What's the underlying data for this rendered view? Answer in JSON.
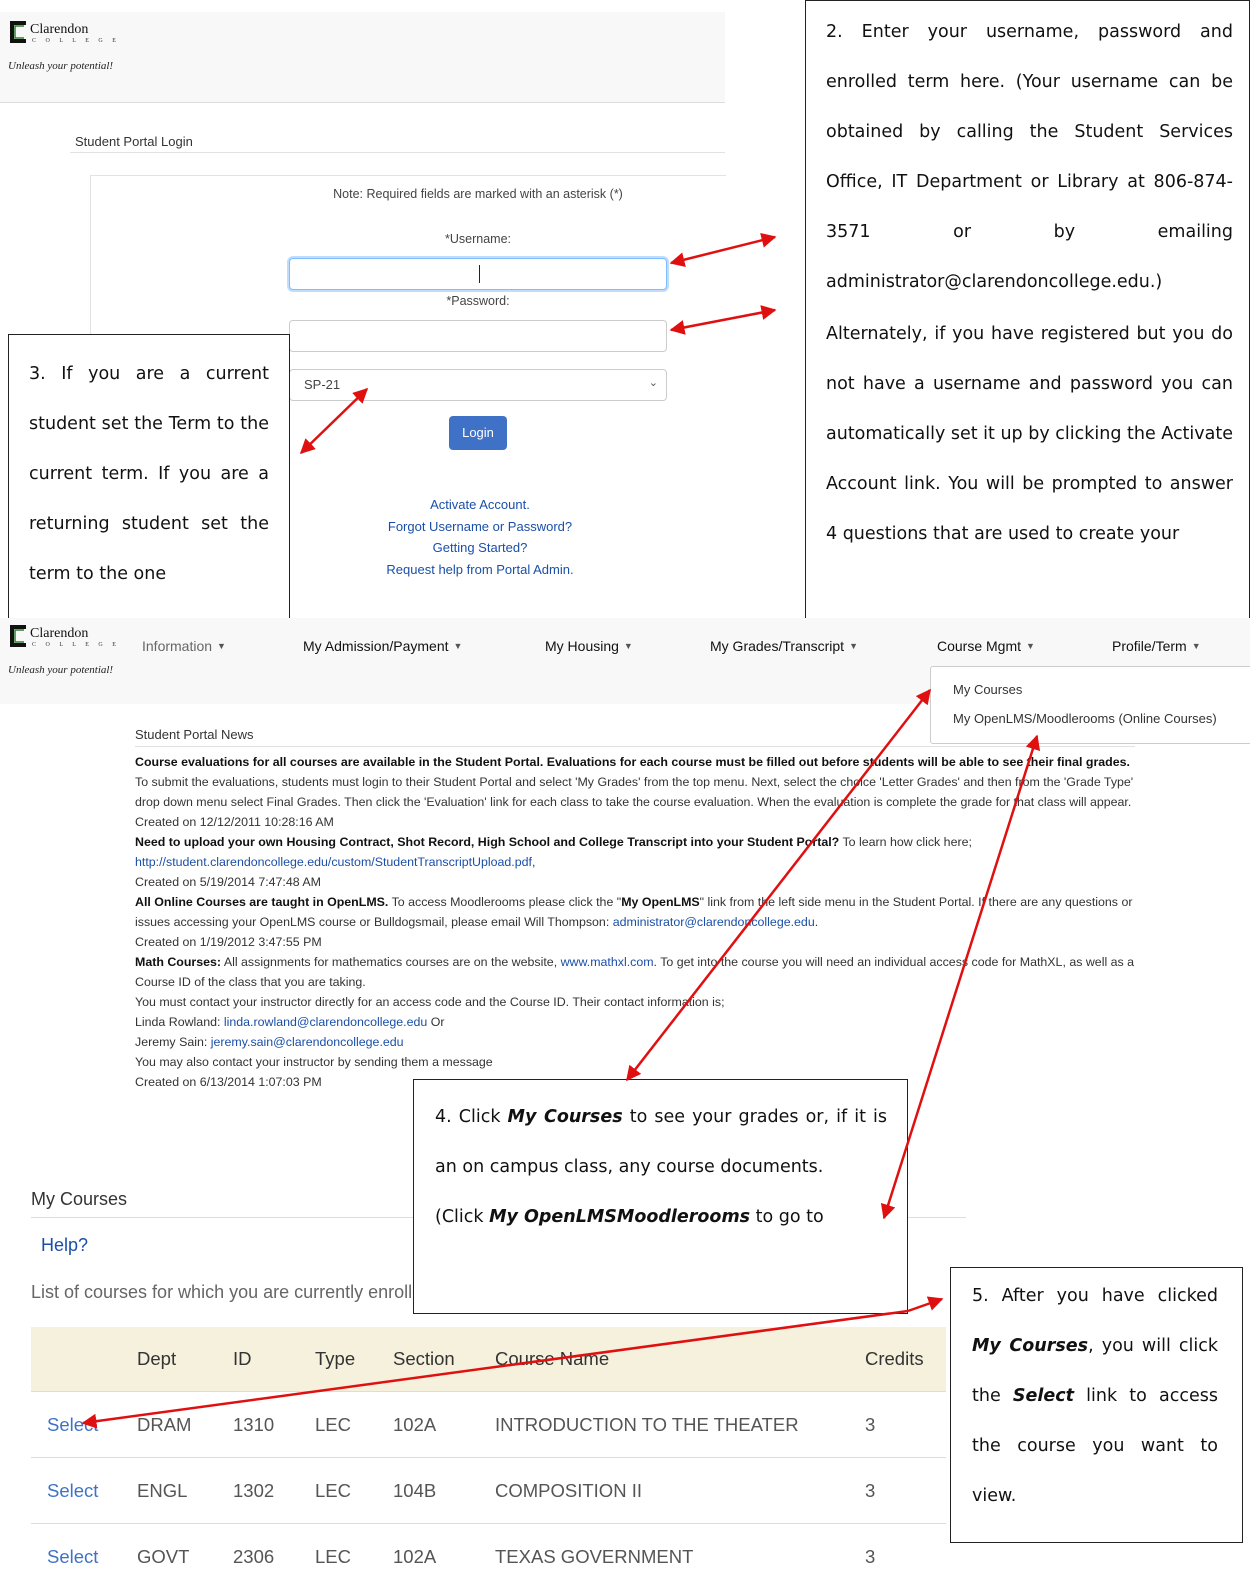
{
  "brand": {
    "name": "Clarendon",
    "sub": "C O L L E G E",
    "tagline": "Unleash your potential!"
  },
  "login": {
    "title": "Student Portal Login",
    "note": "Note: Required fields are marked with an asterisk (*)",
    "username_label": "*Username:",
    "password_label": "*Password:",
    "term_value": "SP-21",
    "login_button": "Login",
    "links": [
      "Activate Account.",
      "Forgot Username or Password?",
      "Getting Started?",
      "Request help from Portal Admin."
    ]
  },
  "callouts": {
    "c2_p1": "2. Enter your username, password and enrolled term here. (Your username can be obtained by calling the Student Services Office, IT Department or Library at 806-874-3571 or by emailing administrator@clarendoncollege.edu.)",
    "c2_p2": "Alternately, if you have registered but you do not have a username and password you can automatically set it up by clicking the Activate Account link. You will be prompted to answer 4 questions that are used to create your",
    "c3": "3. If you are a current student set the Term to the current term. If you are a returning student set the term to the one",
    "c4_a": "4. Click ",
    "c4_em1": "My Courses",
    "c4_b": " to see your grades or, if it is an on campus class, any course documents.",
    "c4_c": "(Click ",
    "c4_em2": "My OpenLMSMoodlerooms",
    "c4_d": " to go to",
    "c5_a": "5. After you have clicked ",
    "c5_em1": "My Courses",
    "c5_b": ", you will click the ",
    "c5_em2": "Select",
    "c5_c": " link to access the course you want to view."
  },
  "nav": {
    "items": [
      "Information",
      "My Admission/Payment",
      "My Housing",
      "My Grades/Transcript",
      "Course Mgmt",
      "Profile/Term"
    ],
    "dropdown": [
      "My Courses",
      "My OpenLMS/Moodlerooms (Online Courses)"
    ]
  },
  "news": {
    "title": "Student Portal News",
    "n1_bold": "Course evaluations for all courses are available in the Student Portal. Evaluations for each course must be filled out before students will be able to see their final grades.",
    "n1_text": " To submit the evaluations, students must login to their Student Portal and select 'My Grades' from the top menu. Next, select the choice 'Letter Grades' and then from the 'Grade Type' drop down menu select Final Grades. Then click the 'Evaluation' link for each class to take the course evaluation. When the evaluation is complete the grade for that class will appear.",
    "n1_date": "Created on 12/12/2011 10:28:16 AM",
    "n2_bold": "Need to upload your own Housing Contract, Shot Record, High School and College Transcript into your Student Portal?",
    "n2_text": " To learn how click here;",
    "n2_link": "http://student.clarendoncollege.edu/custom/StudentTranscriptUpload.pdf",
    "n2_date": "Created on 5/19/2014 7:47:48 AM",
    "n3_bold": "All Online Courses are taught in OpenLMS.",
    "n3_text": " To access Moodlerooms please click the \"",
    "n3_bold2": "My OpenLMS",
    "n3_text2": "\" link from the left side menu in the Student Portal. If there are any questions or issues accessing your OpenLMS course or Bulldogsmail, please email Will Thompson: ",
    "n3_link": "administrator@clarendoncollege.edu",
    "n3_date": "Created on 1/19/2012 3:47:55 PM",
    "n4_bold": "Math Courses:",
    "n4_text": " All assignments for mathematics courses are on the website, ",
    "n4_link": "www.mathxl.com",
    "n4_text2": ". To get into the course you will need an individual access code for MathXL, as well as a Course ID of the class that you are taking.",
    "n4_line2": "You must contact your instructor directly for an access code and the Course ID. Their contact information is;",
    "n4_line3a": "Linda Rowland: ",
    "n4_link2": "linda.rowland@clarendoncollege.edu",
    "n4_line3b": " Or",
    "n4_line4a": "Jeremy Sain: ",
    "n4_link3": "jeremy.sain@clarendoncollege.edu",
    "n4_line5": "You may also contact your instructor by sending them a message",
    "n4_date": "Created on 6/13/2014 1:07:03 PM"
  },
  "courses": {
    "title": "My Courses",
    "help": "Help?",
    "desc": "List of courses for which you are currently enrolled",
    "columns": [
      "",
      "Dept",
      "ID",
      "Type",
      "Section",
      "Course Name",
      "Credits"
    ],
    "rows": [
      {
        "select": "Select",
        "dept": "DRAM",
        "id": "1310",
        "type": "LEC",
        "section": "102A",
        "name": "INTRODUCTION TO THE THEATER",
        "credits": "3"
      },
      {
        "select": "Select",
        "dept": "ENGL",
        "id": "1302",
        "type": "LEC",
        "section": "104B",
        "name": "COMPOSITION II",
        "credits": "3"
      },
      {
        "select": "Select",
        "dept": "GOVT",
        "id": "2306",
        "type": "LEC",
        "section": "102A",
        "name": "TEXAS GOVERNMENT",
        "credits": "3"
      }
    ]
  },
  "colors": {
    "arrow": "#e01010",
    "link": "#1a4fa8",
    "button": "#3f72c6"
  }
}
